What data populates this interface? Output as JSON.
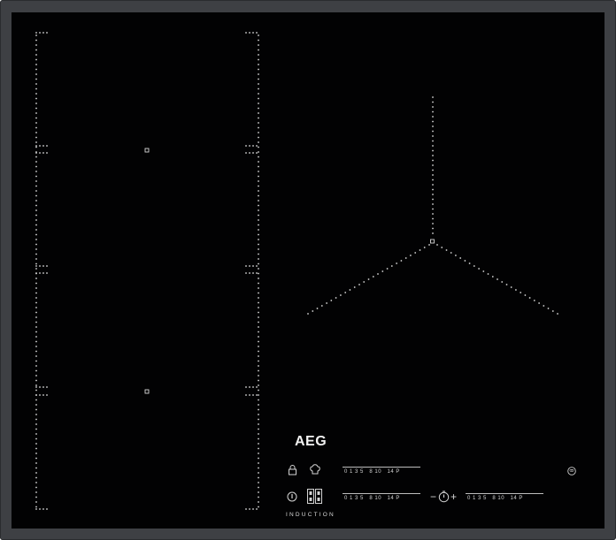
{
  "brand": "AEG",
  "label": "INDUCTION",
  "icons": [
    "lock-icon",
    "chef-hat-icon",
    "power-icon",
    "zone-select-icon",
    "timer-icon",
    "wifi-hob2hood-icon"
  ],
  "sliders": [
    {
      "scale": "0 1 3 5   8 10   14 P"
    },
    {
      "scale": "0 1 3 5   8 10   14 P"
    },
    {
      "scale": "0 1 3 5   8 10   14 P"
    }
  ],
  "timer": {
    "minus": "−",
    "plus": "+"
  },
  "colors": {
    "frame": "#3e4044",
    "glass": "#020203",
    "print": "#d0d0d0"
  }
}
